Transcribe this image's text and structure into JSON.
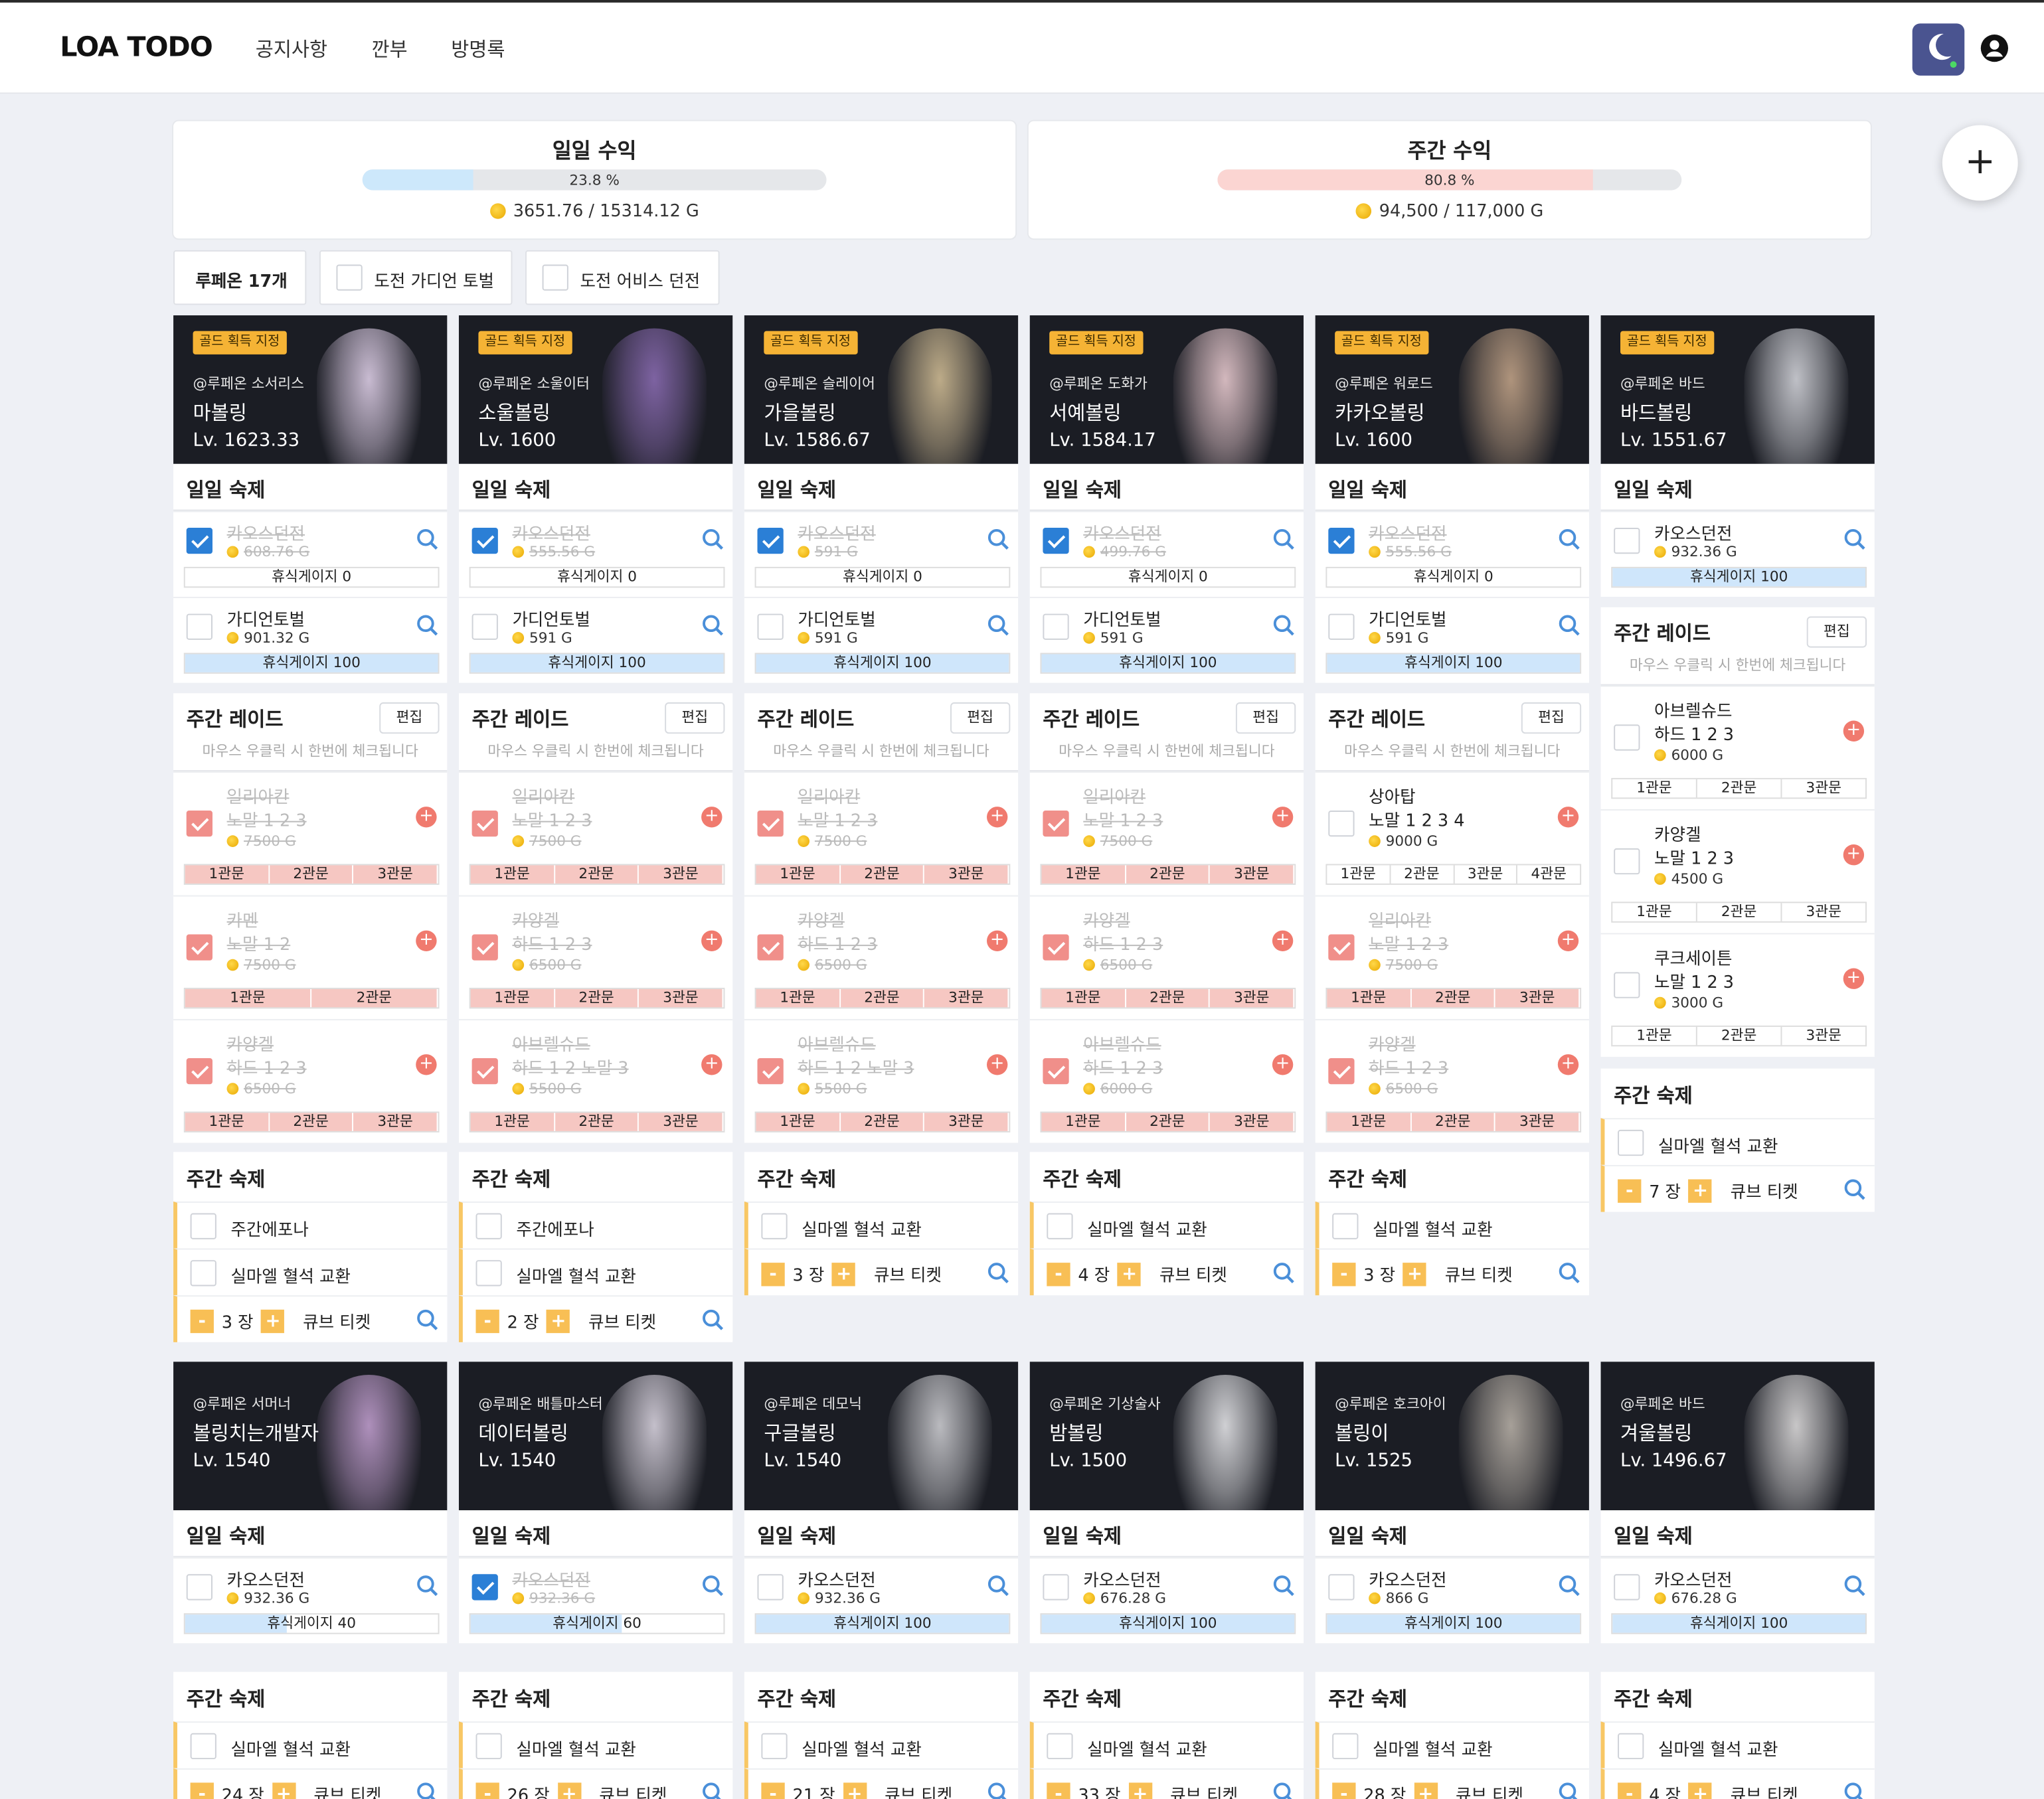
{
  "header": {
    "logo": "LOA TODO",
    "nav": [
      "공지사항",
      "깐부",
      "방명록"
    ]
  },
  "earnings": {
    "daily": {
      "title": "일일 수익",
      "percent": "23.8 %",
      "gold": "3651.76 / 15314.12 G",
      "ratio": 0.238,
      "color": "#cde8fb"
    },
    "weekly": {
      "title": "주간 수익",
      "percent": "80.8 %",
      "gold": "94,500 / 117,000 G",
      "ratio": 0.808,
      "color": "#fbd5d2"
    }
  },
  "filters": {
    "server": "루페온 17개",
    "guardian": "도전 가디언 토벌",
    "abyss": "도전 어비스 던전"
  },
  "labels": {
    "daily": "일일 숙제",
    "weeklyRaid": "주간 레이드",
    "weeklyHw": "주간 숙제",
    "edit": "편집",
    "hint": "마우스 우클릭 시 한번에 체크됩니다",
    "chaos": "카오스던전",
    "guardian": "가디언토벌",
    "gold_tag": "골드 획득 지정",
    "ticket": "큐브 티켓",
    "unit": "장",
    "silmael": "실마엘 혈석 교환",
    "epona": "주간에포나"
  },
  "row1": [
    {
      "srv": "@루페온 소서리스",
      "name": "마볼링",
      "lv": "Lv. 1623.33",
      "chaosG": "608.76 G",
      "chaosDone": true,
      "rest": "휴식게이지 0",
      "guardG": "901.32 G",
      "guardRest": "휴식게이지 100",
      "tickets": "3 장",
      "weekly": [
        "주간에포나",
        "실마엘 혈석 교환"
      ],
      "raids": [
        {
          "n1": "일리아칸",
          "n2": "노말 1 2 3",
          "g": "7500 G",
          "gates": [
            "1관문",
            "2관문",
            "3관문"
          ],
          "done": true
        },
        {
          "n1": "카멘",
          "n2": "노말 1 2",
          "g": "7500 G",
          "gates": [
            "1관문",
            "2관문"
          ],
          "done": true
        },
        {
          "n1": "카양겔",
          "n2": "하드 1 2 3",
          "g": "6500 G",
          "gates": [
            "1관문",
            "2관문",
            "3관문"
          ],
          "done": true
        }
      ],
      "color": "#e7d7f0"
    },
    {
      "srv": "@루페온 소울이터",
      "name": "소울볼링",
      "lv": "Lv. 1600",
      "chaosG": "555.56 G",
      "chaosDone": true,
      "rest": "휴식게이지 0",
      "guardG": "591 G",
      "guardRest": "휴식게이지 100",
      "tickets": "2 장",
      "weekly": [
        "주간에포나",
        "실마엘 혈석 교환"
      ],
      "raids": [
        {
          "n1": "일리아칸",
          "n2": "노말 1 2 3",
          "g": "7500 G",
          "gates": [
            "1관문",
            "2관문",
            "3관문"
          ],
          "done": true
        },
        {
          "n1": "카양겔",
          "n2": "하드 1 2 3",
          "g": "6500 G",
          "gates": [
            "1관문",
            "2관문",
            "3관문"
          ],
          "done": true
        },
        {
          "n1": "아브렐슈드",
          "n2": "하드 1 2 노말 3",
          "g": "5500 G",
          "gates": [
            "1관문",
            "2관문",
            "3관문"
          ],
          "done": true
        }
      ],
      "color": "#8f6fb8"
    },
    {
      "srv": "@루페온 슬레이어",
      "name": "가을볼링",
      "lv": "Lv. 1586.67",
      "chaosG": "591 G",
      "chaosDone": true,
      "rest": "휴식게이지 0",
      "guardG": "591 G",
      "guardRest": "휴식게이지 100",
      "tickets": "3 장",
      "weekly": [
        "실마엘 혈석 교환"
      ],
      "raids": [
        {
          "n1": "일리아칸",
          "n2": "노말 1 2 3",
          "g": "7500 G",
          "gates": [
            "1관문",
            "2관문",
            "3관문"
          ],
          "done": true
        },
        {
          "n1": "카양겔",
          "n2": "하드 1 2 3",
          "g": "6500 G",
          "gates": [
            "1관문",
            "2관문",
            "3관문"
          ],
          "done": true
        },
        {
          "n1": "아브렐슈드",
          "n2": "하드 1 2 노말 3",
          "g": "5500 G",
          "gates": [
            "1관문",
            "2관문",
            "3관문"
          ],
          "done": true
        }
      ],
      "color": "#d9c49a"
    },
    {
      "srv": "@루페온 도화가",
      "name": "서예볼링",
      "lv": "Lv. 1584.17",
      "chaosG": "499.76 G",
      "chaosDone": true,
      "rest": "휴식게이지 0",
      "guardG": "591 G",
      "guardRest": "휴식게이지 100",
      "tickets": "4 장",
      "weekly": [
        "실마엘 혈석 교환"
      ],
      "raids": [
        {
          "n1": "일리아칸",
          "n2": "노말 1 2 3",
          "g": "7500 G",
          "gates": [
            "1관문",
            "2관문",
            "3관문"
          ],
          "done": true
        },
        {
          "n1": "카양겔",
          "n2": "하드 1 2 3",
          "g": "6500 G",
          "gates": [
            "1관문",
            "2관문",
            "3관문"
          ],
          "done": true
        },
        {
          "n1": "아브렐슈드",
          "n2": "하드 1 2 3",
          "g": "6000 G",
          "gates": [
            "1관문",
            "2관문",
            "3관문"
          ],
          "done": true
        }
      ],
      "color": "#f3d3d8"
    },
    {
      "srv": "@루페온 워로드",
      "name": "카카오볼링",
      "lv": "Lv. 1600",
      "chaosG": "555.56 G",
      "chaosDone": true,
      "rest": "휴식게이지 0",
      "guardG": "591 G",
      "guardRest": "휴식게이지 100",
      "tickets": "3 장",
      "weekly": [
        "실마엘 혈석 교환"
      ],
      "raids": [
        {
          "n1": "상아탑",
          "n2": "노말 1 2 3 4",
          "g": "9000 G",
          "gates": [
            "1관문",
            "2관문",
            "3관문",
            "4관문"
          ],
          "done": false
        },
        {
          "n1": "일리아칸",
          "n2": "노말 1 2 3",
          "g": "7500 G",
          "gates": [
            "1관문",
            "2관문",
            "3관문"
          ],
          "done": true
        },
        {
          "n1": "카양겔",
          "n2": "하드 1 2 3",
          "g": "6500 G",
          "gates": [
            "1관문",
            "2관문",
            "3관문"
          ],
          "done": true
        }
      ],
      "color": "#c9a98c"
    }
  ],
  "bard1": {
    "srv": "@루페온 바드",
    "name": "바드볼링",
    "lv": "Lv. 1551.67",
    "chaosG": "932.36 G",
    "rest": "휴식게이지 100",
    "tickets": "7 장",
    "raids": [
      {
        "n1": "아브렐슈드",
        "n2": "하드 1 2 3",
        "g": "6000 G",
        "gates": [
          "1관문",
          "2관문",
          "3관문"
        ]
      },
      {
        "n1": "카양겔",
        "n2": "노말 1 2 3",
        "g": "4500 G",
        "gates": [
          "1관문",
          "2관문",
          "3관문"
        ]
      },
      {
        "n1": "쿠크세이튼",
        "n2": "노말 1 2 3",
        "g": "3000 G",
        "gates": [
          "1관문",
          "2관문",
          "3관문"
        ]
      }
    ],
    "color": "#dcdde3"
  },
  "row2": [
    {
      "srv": "@루페온 서머너",
      "name": "볼링치는개발자",
      "lv": "Lv. 1540",
      "chaosG": "932.36 G",
      "done": false,
      "rest": "휴식게이지 40",
      "restRatio": 0.4,
      "tickets": "24 장",
      "color": "#c8a4d6"
    },
    {
      "srv": "@루페온 배틀마스터",
      "name": "데이터볼링",
      "lv": "Lv. 1540",
      "chaosG": "932.36 G",
      "done": true,
      "rest": "휴식게이지 60",
      "restRatio": 0.6,
      "tickets": "26 장",
      "color": "#e2dce8"
    },
    {
      "srv": "@루페온 데모닉",
      "name": "구글볼링",
      "lv": "Lv. 1540",
      "chaosG": "932.36 G",
      "done": false,
      "rest": "휴식게이지 100",
      "restRatio": 1,
      "tickets": "21 장",
      "color": "#d6d6da"
    },
    {
      "srv": "@루페온 기상술사",
      "name": "밤볼링",
      "lv": "Lv. 1500",
      "chaosG": "676.28 G",
      "done": false,
      "rest": "휴식게이지 100",
      "restRatio": 1,
      "tickets": "33 장",
      "color": "#efeff2"
    },
    {
      "srv": "@루페온 호크아이",
      "name": "볼링이",
      "lv": "Lv. 1525",
      "chaosG": "866 G",
      "done": false,
      "rest": "휴식게이지 100",
      "restRatio": 1,
      "tickets": "28 장",
      "color": "#bfb7ad"
    },
    {
      "srv": "@루페온 바드",
      "name": "겨울볼링",
      "lv": "Lv. 1496.67",
      "chaosG": "676.28 G",
      "done": false,
      "rest": "휴식게이지 100",
      "restRatio": 1,
      "tickets": "4 장",
      "color": "#e6e4e4"
    }
  ]
}
